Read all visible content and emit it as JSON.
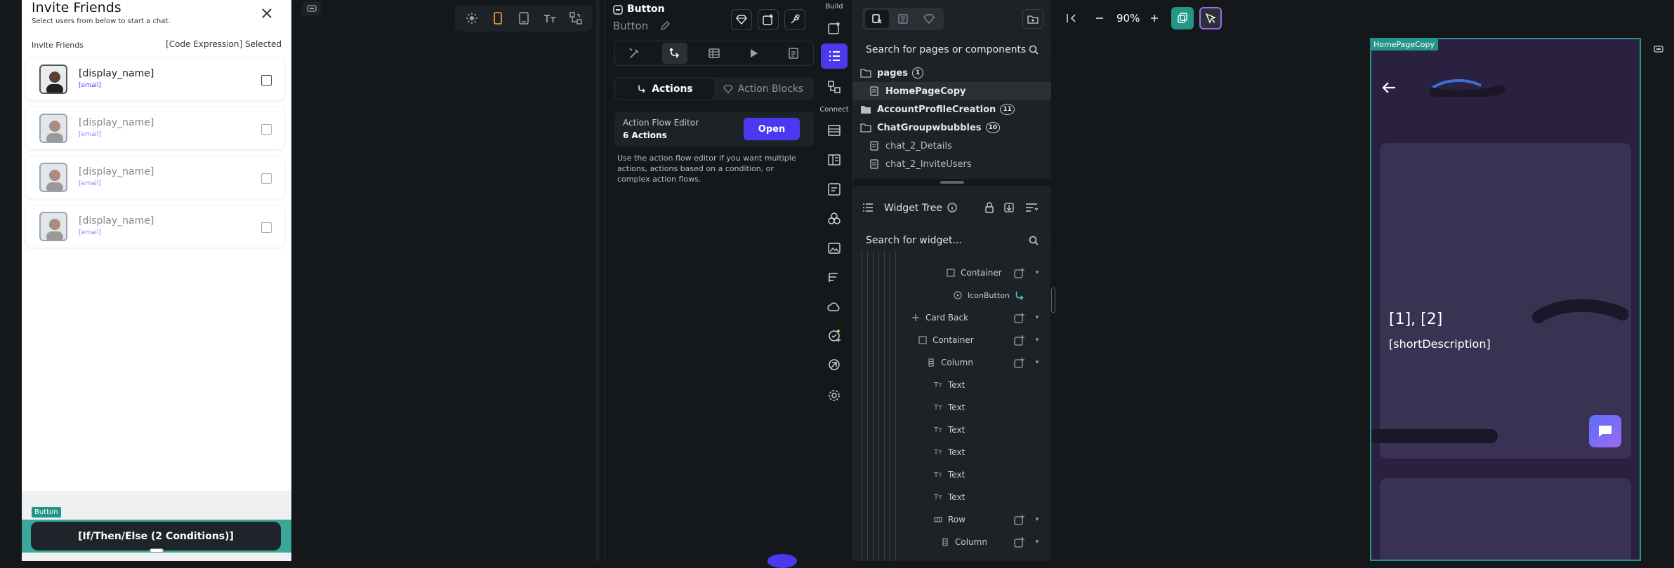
{
  "left_preview": {
    "title": "Invite Friends",
    "subtitle": "Select users from below to start a chat.",
    "list_label": "Invite Friends",
    "selected_label": "[Code Expression] Selected",
    "users": [
      {
        "name": "[display_name]",
        "email": "[email]"
      },
      {
        "name": "[display_name]",
        "email": "[email]"
      },
      {
        "name": "[display_name]",
        "email": "[email]"
      },
      {
        "name": "[display_name]",
        "email": "[email]"
      }
    ],
    "button_tag": "Button",
    "button_label": "[If/Then/Else (2 Conditions)]"
  },
  "properties": {
    "title": "Button",
    "subtitle": "Button",
    "segments": {
      "actions": "Actions",
      "action_blocks": "Action Blocks"
    },
    "flow_editor": {
      "title": "Action Flow Editor",
      "count": "6 Actions",
      "open": "Open"
    },
    "help": "Use the action flow editor if you want multiple actions, actions based on a condition, or complex action flows."
  },
  "vnav": {
    "build": "Build",
    "connect": "Connect"
  },
  "pages": {
    "search_placeholder": "Search for pages or components...",
    "items": [
      {
        "label": "pages",
        "count": "1",
        "type": "folder"
      },
      {
        "label": "HomePageCopy",
        "type": "page",
        "selected": true
      },
      {
        "label": "AccountProfileCreation",
        "count": "11",
        "type": "folder"
      },
      {
        "label": "ChatGroupwbubbles",
        "count": "10",
        "type": "folder"
      },
      {
        "label": "chat_2_Details",
        "type": "child"
      },
      {
        "label": "chat_2_InviteUsers",
        "type": "child"
      }
    ]
  },
  "widget_tree": {
    "title": "Widget Tree",
    "search_placeholder": "Search for widget...",
    "rows": [
      {
        "label": "Container"
      },
      {
        "label": "IconButton"
      },
      {
        "label": "Card Back"
      },
      {
        "label": "Container"
      },
      {
        "label": "Column"
      },
      {
        "label": "Text"
      },
      {
        "label": "Text"
      },
      {
        "label": "Text"
      },
      {
        "label": "Text"
      },
      {
        "label": "Text"
      },
      {
        "label": "Text"
      },
      {
        "label": "Row"
      },
      {
        "label": "Column"
      }
    ]
  },
  "right_canvas": {
    "zoom": "90%",
    "page_label": "HomePageCopy",
    "text1": "[1], [2]",
    "text2": "[shortDescription]"
  },
  "colors": {
    "accent": "#4b39ef",
    "teal": "#249689",
    "panel": "#1d2226",
    "bg": "#14181b"
  }
}
